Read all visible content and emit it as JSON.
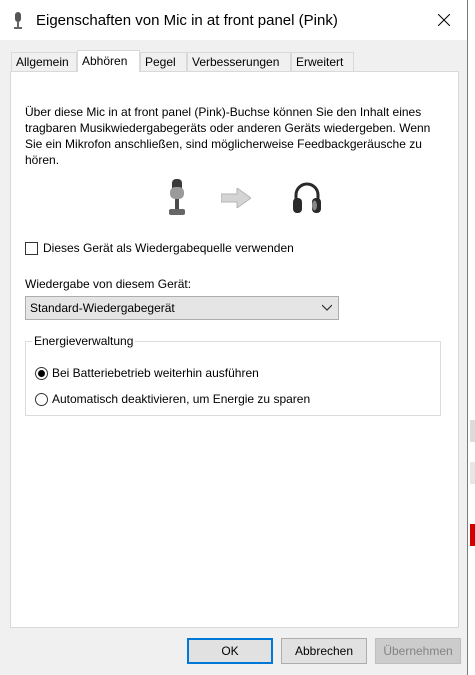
{
  "window": {
    "title": "Eigenschaften von Mic in at front panel (Pink)"
  },
  "tabs": [
    {
      "label": "Allgemein",
      "active": false
    },
    {
      "label": "Abhören",
      "active": true
    },
    {
      "label": "Pegel",
      "active": false
    },
    {
      "label": "Verbesserungen",
      "active": false
    },
    {
      "label": "Erweitert",
      "active": false
    }
  ],
  "panel": {
    "description": "Über diese Mic in at front panel (Pink)-Buchse können Sie den Inhalt eines tragbaren Musikwiedergabegeräts oder anderen Geräts wiedergeben. Wenn Sie ein Mikrofon anschließen, sind möglicherweise Feedbackgeräusche zu hören.",
    "checkbox_label": "Dieses Gerät als Wiedergabequelle verwenden",
    "checkbox_checked": false,
    "playback_label": "Wiedergabe von diesem Gerät:",
    "playback_selected": "Standard-Wiedergabegerät",
    "power_group": {
      "legend": "Energieverwaltung",
      "options": [
        {
          "label": "Bei Batteriebetrieb weiterhin ausführen",
          "checked": true
        },
        {
          "label": "Automatisch deaktivieren, um Energie zu sparen",
          "checked": false
        }
      ]
    }
  },
  "buttons": {
    "ok": "OK",
    "cancel": "Abbrechen",
    "apply": "Übernehmen"
  },
  "colors": {
    "accent": "#0078d7",
    "window_bg": "#f0f0f0",
    "panel_bg": "#ffffff"
  }
}
